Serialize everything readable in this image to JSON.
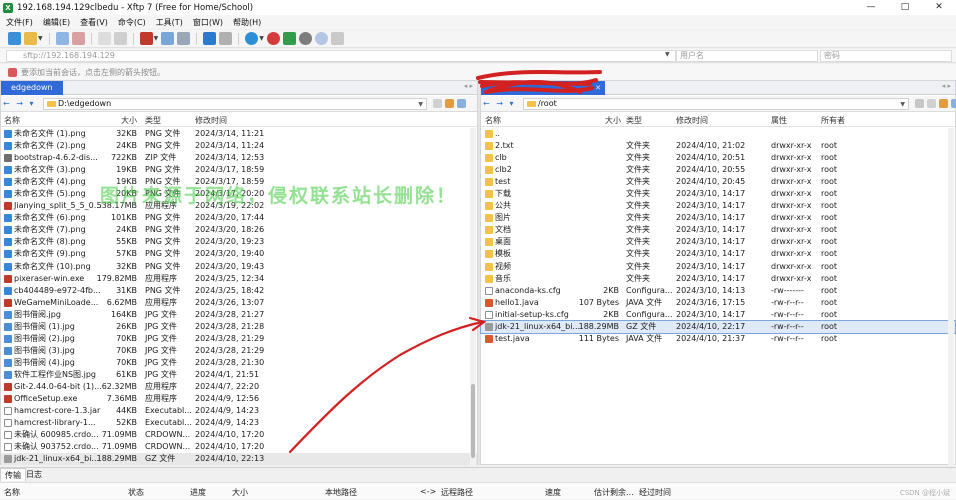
{
  "window": {
    "title": "192.168.194.129clbedu - Xftp 7 (Free for Home/School)",
    "controls": [
      "—",
      "□",
      "✕"
    ]
  },
  "menu": [
    "文件(F)",
    "编辑(E)",
    "查看(V)",
    "命令(C)",
    "工具(T)",
    "窗口(W)",
    "帮助(H)"
  ],
  "address": {
    "host": "sftp://192.168.194.129",
    "username_placeholder": "用户名",
    "password_placeholder": "密码"
  },
  "hint": "要添加当前会话，点击左侧的箭头按钮。",
  "left": {
    "tab": "edgedown",
    "path": "D:\\edgedown",
    "columns": {
      "name": "名称",
      "size": "大小",
      "type": "类型",
      "modified": "修改时间"
    },
    "files": [
      {
        "name": "未命名文件 (1).png",
        "size": "32KB",
        "type": "PNG 文件",
        "modified": "2024/3/14, 11:21",
        "icon": "png"
      },
      {
        "name": "未命名文件 (2).png",
        "size": "24KB",
        "type": "PNG 文件",
        "modified": "2024/3/14, 11:24",
        "icon": "png"
      },
      {
        "name": "bootstrap-4.6.2-dis...",
        "size": "722KB",
        "type": "ZIP 文件",
        "modified": "2024/3/14, 12:53",
        "icon": "zip"
      },
      {
        "name": "未命名文件 (3).png",
        "size": "19KB",
        "type": "PNG 文件",
        "modified": "2024/3/17, 18:59",
        "icon": "png"
      },
      {
        "name": "未命名文件 (4).png",
        "size": "19KB",
        "type": "PNG 文件",
        "modified": "2024/3/17, 18:59",
        "icon": "png"
      },
      {
        "name": "未命名文件 (5).png",
        "size": "20KB",
        "type": "PNG 文件",
        "modified": "2024/3/17, 20:20",
        "icon": "png"
      },
      {
        "name": "Jianying_split_5_5_0...",
        "size": "538.17MB",
        "type": "应用程序",
        "modified": "2024/3/19, 22:02",
        "icon": "exe"
      },
      {
        "name": "未命名文件 (6).png",
        "size": "101KB",
        "type": "PNG 文件",
        "modified": "2024/3/20, 17:44",
        "icon": "png"
      },
      {
        "name": "未命名文件 (7).png",
        "size": "24KB",
        "type": "PNG 文件",
        "modified": "2024/3/20, 18:26",
        "icon": "png"
      },
      {
        "name": "未命名文件 (8).png",
        "size": "55KB",
        "type": "PNG 文件",
        "modified": "2024/3/20, 19:23",
        "icon": "png"
      },
      {
        "name": "未命名文件 (9).png",
        "size": "57KB",
        "type": "PNG 文件",
        "modified": "2024/3/20, 19:40",
        "icon": "png"
      },
      {
        "name": "未命名文件 (10).png",
        "size": "32KB",
        "type": "PNG 文件",
        "modified": "2024/3/20, 19:43",
        "icon": "png"
      },
      {
        "name": "pixeraser-win.exe",
        "size": "179.82MB",
        "type": "应用程序",
        "modified": "2024/3/25, 12:34",
        "icon": "exe"
      },
      {
        "name": "cb404489-e972-4fb...",
        "size": "31KB",
        "type": "PNG 文件",
        "modified": "2024/3/25, 18:42",
        "icon": "png"
      },
      {
        "name": "WeGameMiniLoade...",
        "size": "6.62MB",
        "type": "应用程序",
        "modified": "2024/3/26, 13:07",
        "icon": "exe"
      },
      {
        "name": "图书借阅.jpg",
        "size": "164KB",
        "type": "JPG 文件",
        "modified": "2024/3/28, 21:27",
        "icon": "jpg"
      },
      {
        "name": "图书借阅 (1).jpg",
        "size": "26KB",
        "type": "JPG 文件",
        "modified": "2024/3/28, 21:28",
        "icon": "jpg"
      },
      {
        "name": "图书借阅 (2).jpg",
        "size": "70KB",
        "type": "JPG 文件",
        "modified": "2024/3/28, 21:29",
        "icon": "jpg"
      },
      {
        "name": "图书借阅 (3).jpg",
        "size": "70KB",
        "type": "JPG 文件",
        "modified": "2024/3/28, 21:29",
        "icon": "jpg"
      },
      {
        "name": "图书借阅 (4).jpg",
        "size": "70KB",
        "type": "JPG 文件",
        "modified": "2024/3/28, 21:30",
        "icon": "jpg"
      },
      {
        "name": "软件工程作业NS图.jpg",
        "size": "61KB",
        "type": "JPG 文件",
        "modified": "2024/4/1, 21:51",
        "icon": "jpg"
      },
      {
        "name": "Git-2.44.0-64-bit (1)...",
        "size": "62.32MB",
        "type": "应用程序",
        "modified": "2024/4/7, 22:20",
        "icon": "exe"
      },
      {
        "name": "OfficeSetup.exe",
        "size": "7.36MB",
        "type": "应用程序",
        "modified": "2024/4/9, 12:56",
        "icon": "exe"
      },
      {
        "name": "hamcrest-core-1.3.jar",
        "size": "44KB",
        "type": "Executabl...",
        "modified": "2024/4/9, 14:23",
        "icon": "file"
      },
      {
        "name": "hamcrest-library-1...",
        "size": "52KB",
        "type": "Executabl...",
        "modified": "2024/4/9, 14:23",
        "icon": "file"
      },
      {
        "name": "未确认 600985.crdo...",
        "size": "71.09MB",
        "type": "CRDOWN...",
        "modified": "2024/4/10, 17:20",
        "icon": "file"
      },
      {
        "name": "未确认 903752.crdo...",
        "size": "71.09MB",
        "type": "CRDOWN...",
        "modified": "2024/4/10, 17:20",
        "icon": "file"
      },
      {
        "name": "jdk-21_linux-x64_bi...",
        "size": "188.29MB",
        "type": "GZ 文件",
        "modified": "2024/4/10, 22:13",
        "icon": "gz"
      }
    ]
  },
  "right": {
    "tab": "",
    "path": "/root",
    "columns": {
      "name": "名称",
      "size": "大小",
      "type": "类型",
      "modified": "修改时间",
      "attr": "属性",
      "owner": "所有者"
    },
    "files": [
      {
        "name": "..",
        "size": "",
        "type": "",
        "modified": "",
        "attr": "",
        "owner": "",
        "icon": "folder"
      },
      {
        "name": "2.txt",
        "size": "",
        "type": "文件夹",
        "modified": "2024/4/10, 21:02",
        "attr": "drwxr-xr-x",
        "owner": "root",
        "icon": "folder"
      },
      {
        "name": "clb",
        "size": "",
        "type": "文件夹",
        "modified": "2024/4/10, 20:51",
        "attr": "drwxr-xr-x",
        "owner": "root",
        "icon": "folder"
      },
      {
        "name": "clb2",
        "size": "",
        "type": "文件夹",
        "modified": "2024/4/10, 20:55",
        "attr": "drwxr-xr-x",
        "owner": "root",
        "icon": "folder"
      },
      {
        "name": "test",
        "size": "",
        "type": "文件夹",
        "modified": "2024/4/10, 20:45",
        "attr": "drwxr-xr-x",
        "owner": "root",
        "icon": "folder"
      },
      {
        "name": "下载",
        "size": "",
        "type": "文件夹",
        "modified": "2024/3/10, 14:17",
        "attr": "drwxr-xr-x",
        "owner": "root",
        "icon": "folder"
      },
      {
        "name": "公共",
        "size": "",
        "type": "文件夹",
        "modified": "2024/3/10, 14:17",
        "attr": "drwxr-xr-x",
        "owner": "root",
        "icon": "folder"
      },
      {
        "name": "图片",
        "size": "",
        "type": "文件夹",
        "modified": "2024/3/10, 14:17",
        "attr": "drwxr-xr-x",
        "owner": "root",
        "icon": "folder"
      },
      {
        "name": "文档",
        "size": "",
        "type": "文件夹",
        "modified": "2024/3/10, 14:17",
        "attr": "drwxr-xr-x",
        "owner": "root",
        "icon": "folder"
      },
      {
        "name": "桌面",
        "size": "",
        "type": "文件夹",
        "modified": "2024/3/10, 14:17",
        "attr": "drwxr-xr-x",
        "owner": "root",
        "icon": "folder"
      },
      {
        "name": "模板",
        "size": "",
        "type": "文件夹",
        "modified": "2024/3/10, 14:17",
        "attr": "drwxr-xr-x",
        "owner": "root",
        "icon": "folder"
      },
      {
        "name": "视频",
        "size": "",
        "type": "文件夹",
        "modified": "2024/3/10, 14:17",
        "attr": "drwxr-xr-x",
        "owner": "root",
        "icon": "folder"
      },
      {
        "name": "音乐",
        "size": "",
        "type": "文件夹",
        "modified": "2024/3/10, 14:17",
        "attr": "drwxr-xr-x",
        "owner": "root",
        "icon": "folder"
      },
      {
        "name": "anaconda-ks.cfg",
        "size": "2KB",
        "type": "Configura...",
        "modified": "2024/3/10, 14:13",
        "attr": "-rw-------",
        "owner": "root",
        "icon": "file"
      },
      {
        "name": "hello1.java",
        "size": "107 Bytes",
        "type": "JAVA 文件",
        "modified": "2024/3/16, 17:15",
        "attr": "-rw-r--r--",
        "owner": "root",
        "icon": "java"
      },
      {
        "name": "initial-setup-ks.cfg",
        "size": "2KB",
        "type": "Configura...",
        "modified": "2024/3/10, 14:17",
        "attr": "-rw-r--r--",
        "owner": "root",
        "icon": "file"
      },
      {
        "name": "jdk-21_linux-x64_bi...",
        "size": "188.29MB",
        "type": "GZ 文件",
        "modified": "2024/4/10, 22:17",
        "attr": "-rw-r--r--",
        "owner": "root",
        "icon": "gz"
      },
      {
        "name": "test.java",
        "size": "111 Bytes",
        "type": "JAVA 文件",
        "modified": "2024/4/10, 21:37",
        "attr": "-rw-r--r--",
        "owner": "root",
        "icon": "java"
      }
    ]
  },
  "bottom": {
    "tabs": [
      "传输",
      "日志"
    ],
    "columns": [
      "名称",
      "状态",
      "进度",
      "大小",
      "本地路径",
      "<->",
      "远程路径",
      "速度",
      "估计剩余...",
      "经过时间"
    ]
  },
  "overlay": {
    "watermark": "图片来源于网络，侵权联系站长删除！",
    "corner": "CSDN @程小斌"
  },
  "colors": {
    "accent": "#2f6ad8",
    "selection": "#dfe9f8",
    "annotation": "#d32020",
    "folder": "#f2c24b"
  }
}
